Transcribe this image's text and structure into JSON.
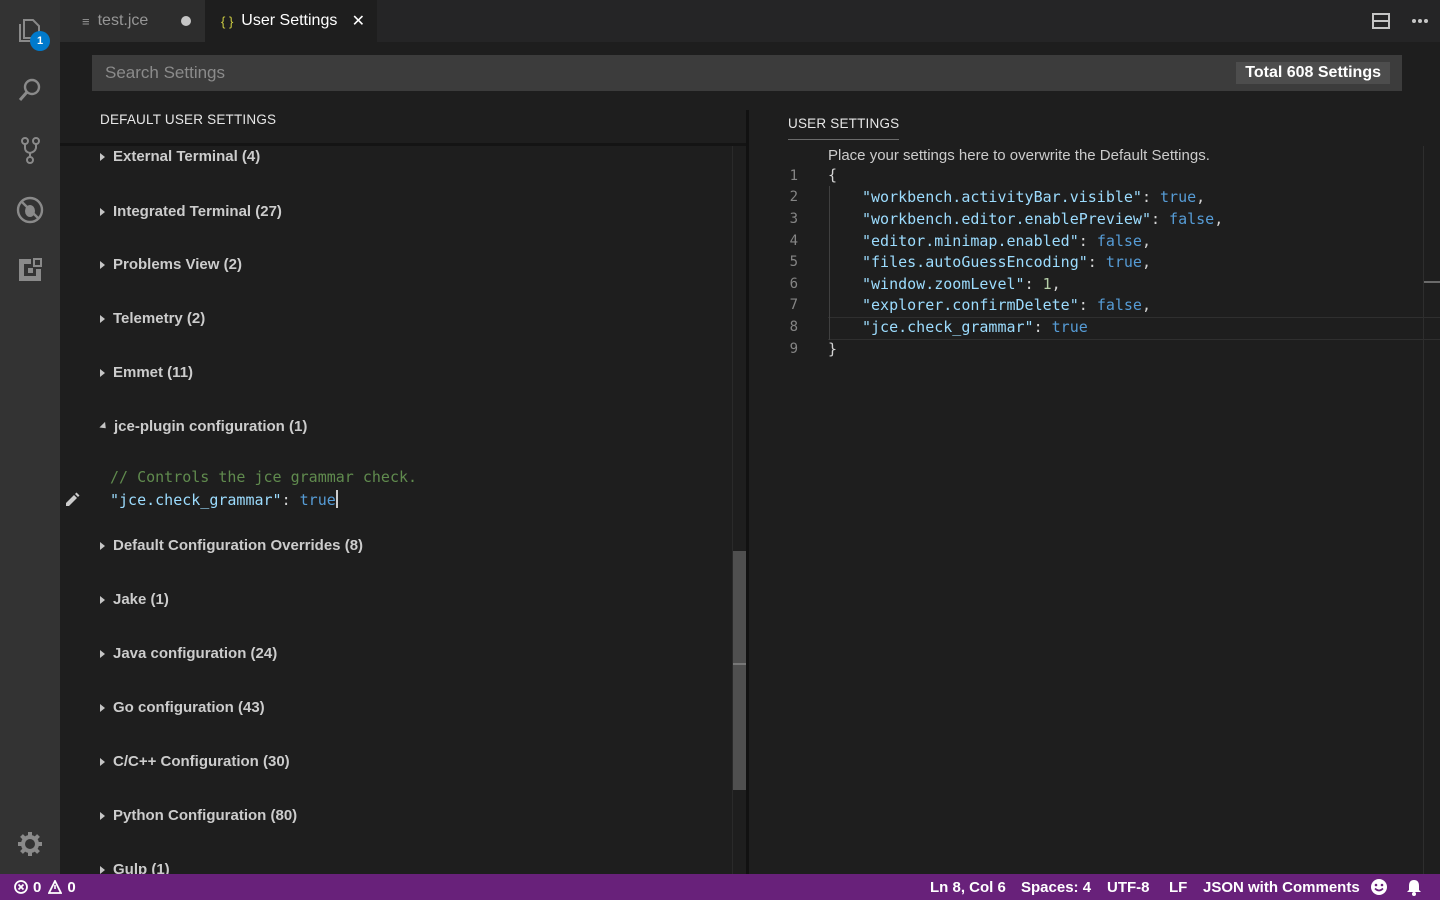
{
  "activity_bar": {
    "items": [
      "files-icon",
      "search-icon",
      "source-control-icon",
      "debug-icon",
      "extensions-icon"
    ],
    "explorer_badge": "1",
    "manage": "gear-icon"
  },
  "tabs": [
    {
      "label": "test.jce",
      "icon": "≡",
      "state": "dirty"
    },
    {
      "label": "User Settings",
      "icon": "{ }",
      "state": "active",
      "close": "✕"
    }
  ],
  "search": {
    "placeholder": "Search Settings",
    "total": "Total 608 Settings"
  },
  "default_settings": {
    "header": "DEFAULT USER SETTINGS",
    "groups": [
      "External Terminal (4)",
      "Integrated Terminal (27)",
      "Problems View (2)",
      "Telemetry (2)",
      "Emmet (11)",
      "jce-plugin configuration (1)",
      "Default Configuration Overrides (8)",
      "Jake (1)",
      "Java configuration (24)",
      "Go configuration (43)",
      "C/C++ Configuration (30)",
      "Python Configuration (80)",
      "Gulp (1)"
    ],
    "expanded": {
      "comment": "// Controls the jce grammar check.",
      "key": "\"jce.check_grammar\"",
      "colon": ": ",
      "value": "true"
    }
  },
  "user_settings": {
    "header": "USER SETTINGS",
    "hint": "Place your settings here to overwrite the Default Settings.",
    "line_numbers": [
      "1",
      "2",
      "3",
      "4",
      "5",
      "6",
      "7",
      "8",
      "9"
    ],
    "open_brace": "{",
    "close_brace": "}",
    "entries": [
      {
        "key": "\"workbench.activityBar.visible\"",
        "value": "true",
        "comma": ","
      },
      {
        "key": "\"workbench.editor.enablePreview\"",
        "value": "false",
        "comma": ","
      },
      {
        "key": "\"editor.minimap.enabled\"",
        "value": "false",
        "comma": ","
      },
      {
        "key": "\"files.autoGuessEncoding\"",
        "value": "true",
        "comma": ","
      },
      {
        "key": "\"window.zoomLevel\"",
        "value": "1",
        "comma": ","
      },
      {
        "key": "\"explorer.confirmDelete\"",
        "value": "false",
        "comma": ","
      },
      {
        "key": "\"jce.check_grammar\"",
        "value": "true",
        "comma": ""
      }
    ]
  },
  "status_bar": {
    "errors": "0",
    "warnings": "0",
    "position": "Ln 8, Col 6",
    "spaces": "Spaces: 4",
    "encoding": "UTF-8",
    "eol": "LF",
    "language": "JSON with Comments",
    "colors": {
      "background": "#68217a"
    }
  },
  "colors": {
    "key": "#9cdcfe",
    "bool": "#569cd6",
    "number": "#b5cea8",
    "comment": "#608b4e",
    "badge": "#007acc"
  }
}
